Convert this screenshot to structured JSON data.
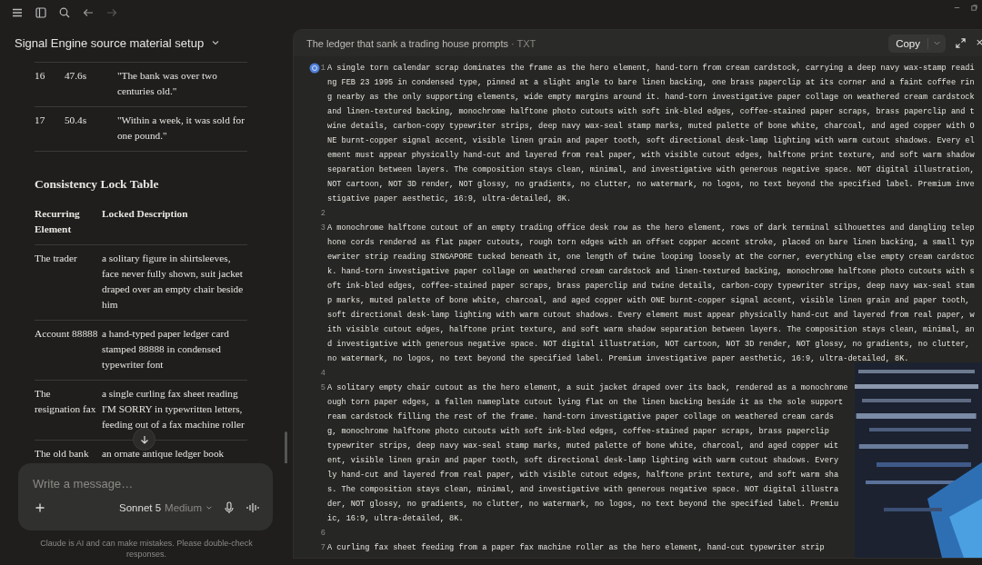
{
  "conversation": {
    "title": "Signal Engine source material setup",
    "timing_rows": [
      {
        "index": "16",
        "time": "47.6s",
        "line": "\"The bank was over two centuries old.\""
      },
      {
        "index": "17",
        "time": "50.4s",
        "line": "\"Within a week, it was sold for one pound.\""
      }
    ],
    "lock_table": {
      "heading": "Consistency Lock Table",
      "columns": [
        "Recurring Element",
        "Locked Description"
      ],
      "rows": [
        {
          "element": "The trader",
          "description": "a solitary figure in shirtsleeves, face never fully shown, suit jacket draped over an empty chair beside him"
        },
        {
          "element": "Account 88888",
          "description": "a hand-typed paper ledger card stamped 88888 in condensed typewriter font"
        },
        {
          "element": "The resignation fax",
          "description": "a single curling fax sheet reading I'M SORRY in typewritten letters, feeding out of a fax machine roller"
        },
        {
          "element": "The old bank",
          "description": "an ornate antique ledger book"
        }
      ]
    }
  },
  "composer": {
    "placeholder": "Write a message…",
    "model": "Sonnet 5",
    "effort": "Medium"
  },
  "disclaimer": "Claude is AI and can make mistakes. Please double-check responses.",
  "artifact": {
    "title": "The ledger that sank a trading house prompts",
    "type": "· TXT",
    "copy_label": "Copy",
    "lines": [
      {
        "number": "1",
        "cursor": true,
        "wrapped": [
          "A single torn calendar scrap dominates the frame as the hero element, hand-torn from cream cardstock, carrying a deep navy wax-stamp readi",
          "ng FEB 23 1995 in condensed type, pinned at a slight angle to bare linen backing, one brass paperclip at its corner and a faint coffee rin",
          "g nearby as the only supporting elements, wide empty margins around it. hand-torn investigative paper collage on weathered cream cardstock",
          "and linen-textured backing, monochrome halftone photo cutouts with soft ink-bled edges, coffee-stained paper scraps, brass paperclip and t",
          "wine details, carbon-copy typewriter strips, deep navy wax-seal stamp marks, muted palette of bone white, charcoal, and aged copper with O",
          "NE burnt-copper signal accent, visible linen grain and paper tooth, soft directional desk-lamp lighting with warm cutout shadows. Every el",
          "ement must appear physically hand-cut and layered from real paper, with visible cutout edges, halftone print texture, and soft warm shadow",
          "separation between layers. The composition stays clean, minimal, and investigative with generous negative space. NOT digital illustration,",
          "NOT cartoon, NOT 3D render, NOT glossy, no gradients, no clutter, no watermark, no logos, no text beyond the specified label. Premium inve",
          "stigative paper aesthetic, 16:9, ultra-detailed, 8K."
        ]
      },
      {
        "number": "2",
        "cursor": false
      },
      {
        "number": "3",
        "cursor": false,
        "wrapped": [
          "A monochrome halftone cutout of an empty trading office desk row as the hero element, rows of dark terminal silhouettes and dangling telep",
          "hone cords rendered as flat paper cutouts, rough torn edges with an offset copper accent stroke, placed on bare linen backing, a small typ",
          "ewriter strip reading SINGAPORE tucked beneath it, one length of twine looping loosely at the corner, everything else empty cream cardstoc",
          "k. hand-torn investigative paper collage on weathered cream cardstock and linen-textured backing, monochrome halftone photo cutouts with s",
          "oft ink-bled edges, coffee-stained paper scraps, brass paperclip and twine details, carbon-copy typewriter strips, deep navy wax-seal stam",
          "p marks, muted palette of bone white, charcoal, and aged copper with ONE burnt-copper signal accent, visible linen grain and paper tooth,",
          "soft directional desk-lamp lighting with warm cutout shadows. Every element must appear physically hand-cut and layered from real paper, w",
          "ith visible cutout edges, halftone print texture, and soft warm shadow separation between layers. The composition stays clean, minimal, an",
          "d investigative with generous negative space. NOT digital illustration, NOT cartoon, NOT 3D render, NOT glossy, no gradients, no clutter,",
          "no watermark, no logos, no text beyond the specified label. Premium investigative paper aesthetic, 16:9, ultra-detailed, 8K."
        ]
      },
      {
        "number": "4",
        "cursor": false
      },
      {
        "number": "5",
        "cursor": false,
        "wrapped": [
          "A solitary empty chair cutout as the hero element, a suit jacket draped over its back, rendered as a monochrome",
          "ough torn paper edges, a fallen nameplate cutout lying flat on the linen backing beside it as the sole support",
          "ream cardstock filling the rest of the frame. hand-torn investigative paper collage on weathered cream cards",
          "g, monochrome halftone photo cutouts with soft ink-bled edges, coffee-stained paper scraps, brass paperclip",
          "typewriter strips, deep navy wax-seal stamp marks, muted palette of bone white, charcoal, and aged copper wit",
          "ent, visible linen grain and paper tooth, soft directional desk-lamp lighting with warm cutout shadows. Every",
          "ly hand-cut and layered from real paper, with visible cutout edges, halftone print texture, and soft warm sha",
          "s. The composition stays clean, minimal, and investigative with generous negative space. NOT digital illustra",
          "der, NOT glossy, no gradients, no clutter, no watermark, no logos, no text beyond the specified label. Premiu",
          "ic, 16:9, ultra-detailed, 8K."
        ]
      },
      {
        "number": "6",
        "cursor": false
      },
      {
        "number": "7",
        "cursor": false,
        "wrapped": [
          "A curling fax sheet feeding from a paper fax machine roller as the hero element, hand-cut typewriter strip"
        ]
      }
    ]
  }
}
